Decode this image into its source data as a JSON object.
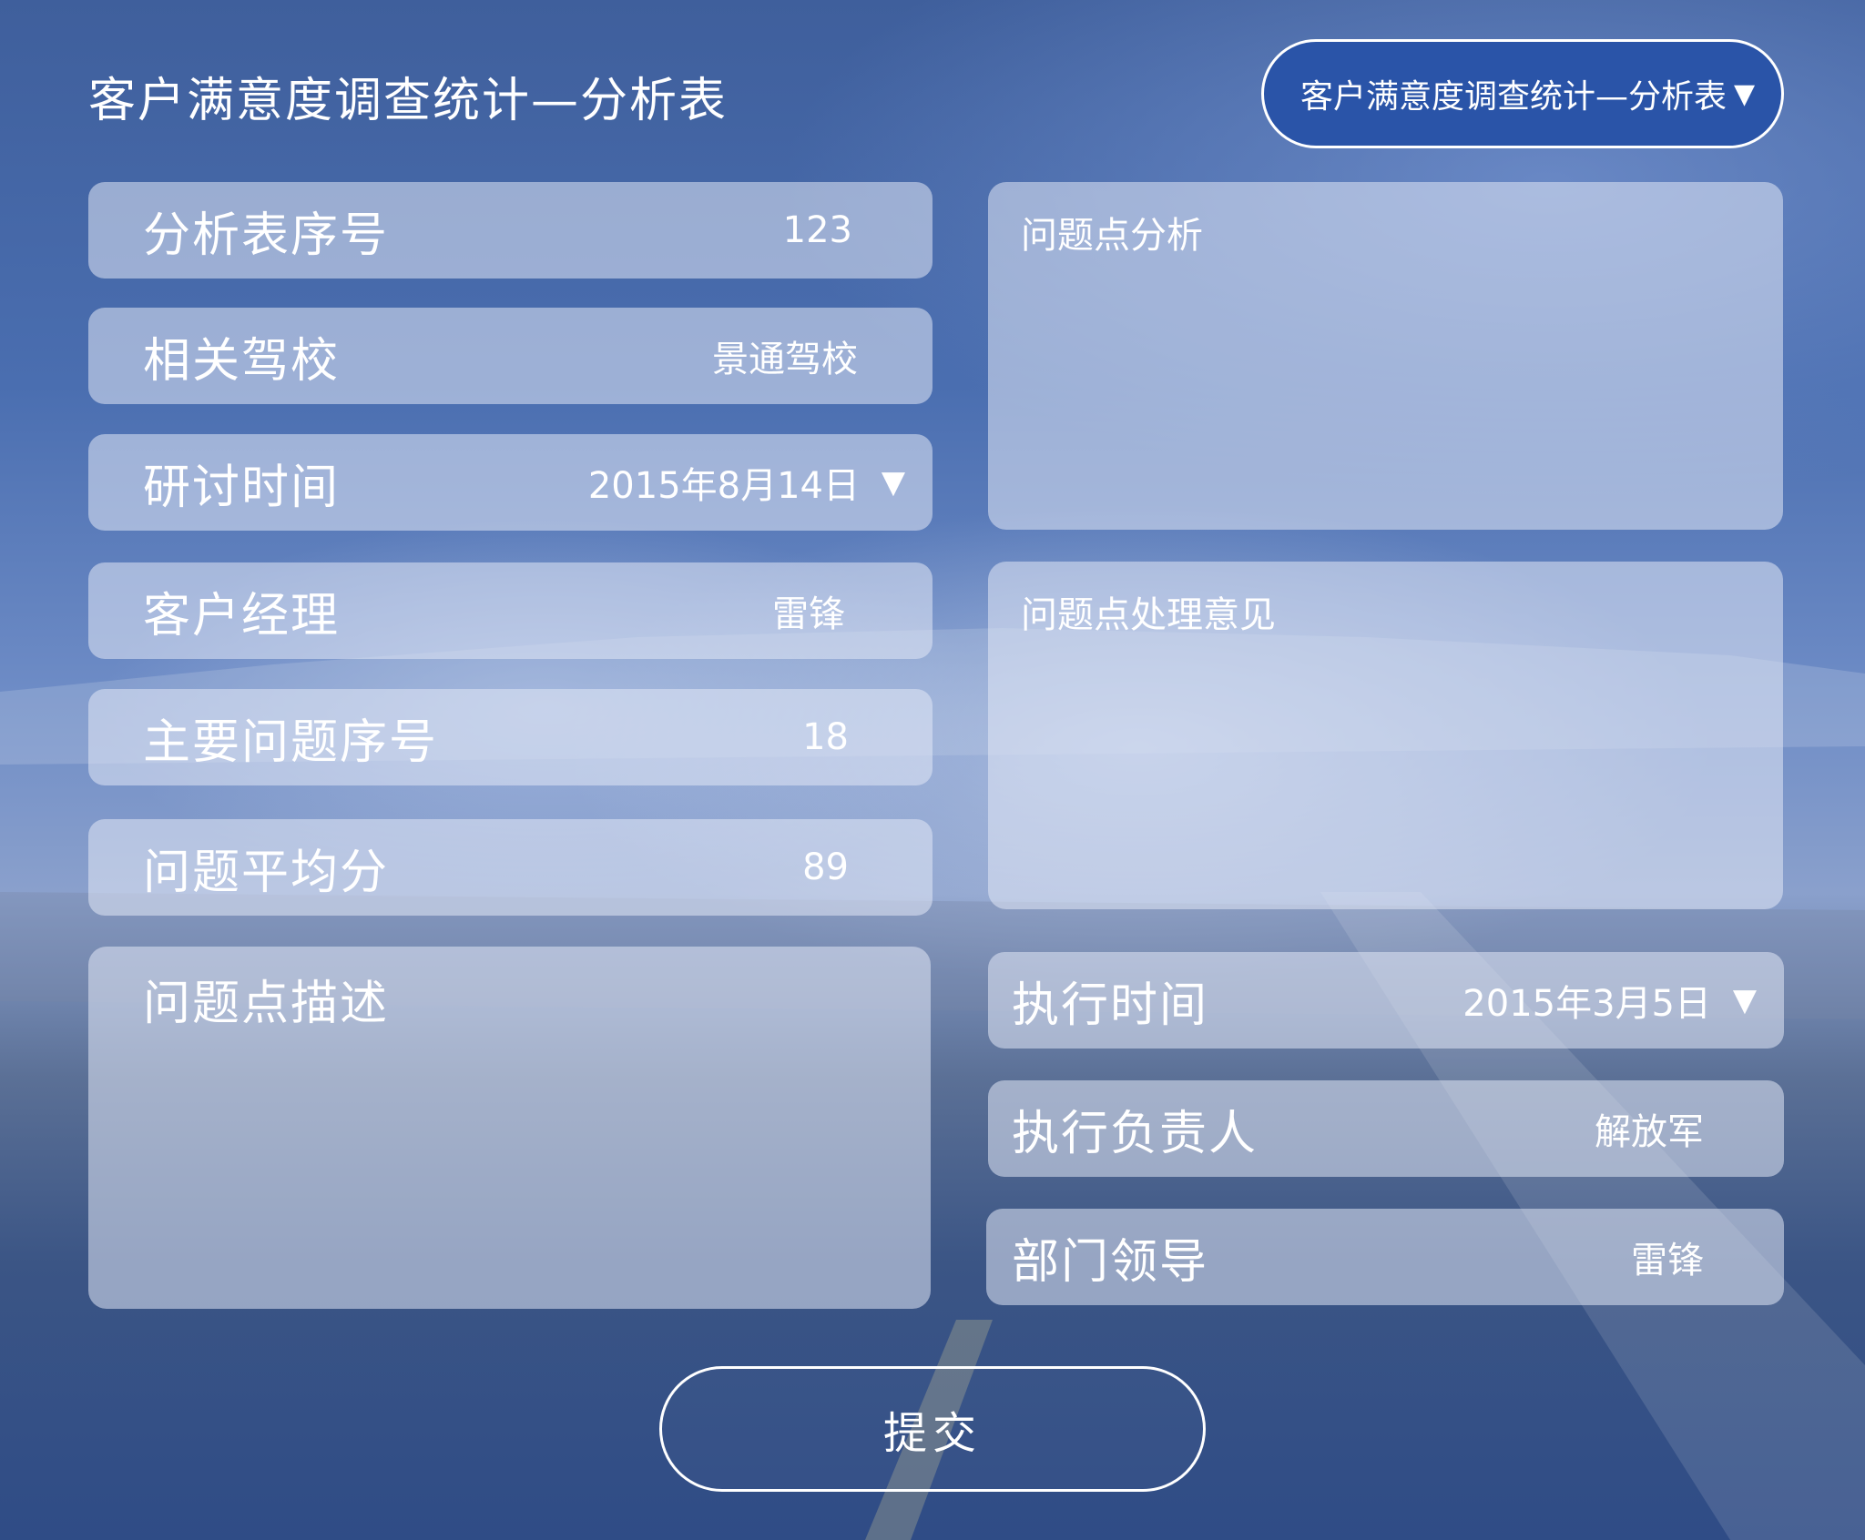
{
  "header": {
    "title": "客户满意度调查统计—分析表",
    "form_selector": {
      "value": "客户满意度调查统计—分析表",
      "caret_icon": "triangle-down-icon"
    }
  },
  "left_fields": [
    {
      "label": "分析表序号",
      "value": "123"
    },
    {
      "label": "相关驾校",
      "value": "景通驾校"
    },
    {
      "label": "研讨时间",
      "value": "2015年8月14日",
      "caret_icon": "triangle-down-icon"
    },
    {
      "label": "客户经理",
      "value": "雷锋"
    },
    {
      "label": "主要问题序号",
      "value": "18"
    },
    {
      "label": "问题平均分",
      "value": "89"
    }
  ],
  "problem_description": {
    "label": "问题点描述",
    "value": ""
  },
  "problem_analysis": {
    "label": "问题点分析",
    "value": ""
  },
  "handling_opinion": {
    "label": "问题点处理意见",
    "value": ""
  },
  "right_fields": [
    {
      "label": "执行时间",
      "value": "2015年3月5日",
      "caret_icon": "triangle-down-icon"
    },
    {
      "label": "执行负责人",
      "value": "解放军"
    },
    {
      "label": "部门领导",
      "value": "雷锋"
    }
  ],
  "submit": {
    "label": "提交"
  },
  "colors": {
    "selector_bg": "#2a54a8",
    "panel_bg": "rgba(225,232,245,0.55)",
    "text": "#ffffff"
  }
}
